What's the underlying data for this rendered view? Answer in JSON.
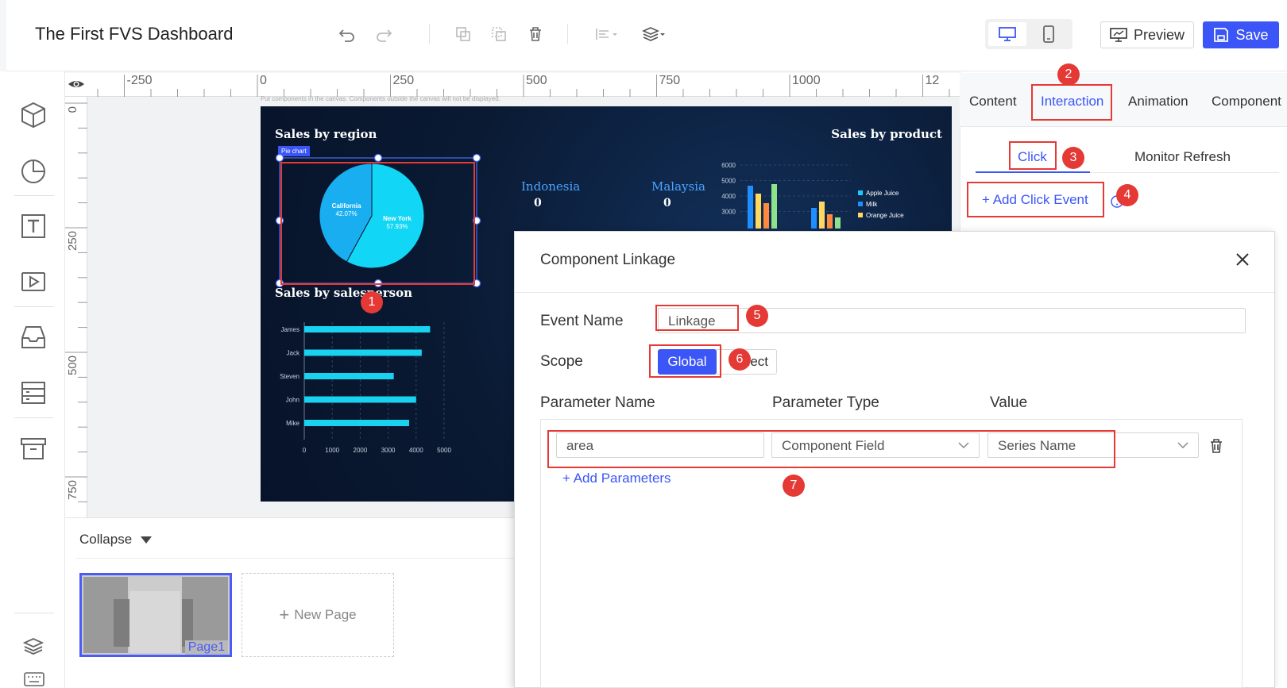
{
  "app": {
    "title": "The First FVS Dashboard",
    "preview_label": "Preview",
    "save_label": "Save",
    "accent": "#3b55f6"
  },
  "toolbar": {
    "icons": [
      "undo-icon",
      "redo-icon",
      "copy-icon",
      "paste-icon",
      "delete-icon",
      "align-icon",
      "layer-icon"
    ]
  },
  "sidebar": {
    "icons": [
      "component-icon",
      "chart-icon",
      "text-icon",
      "media-icon",
      "container-icon",
      "table-icon",
      "archive-icon",
      "layers-icon",
      "keyboard-icon"
    ]
  },
  "ruler": {
    "top_labels": [
      "-250",
      "0",
      "250",
      "500",
      "750",
      "1000",
      "12"
    ],
    "left_labels": [
      "0",
      "250",
      "500",
      "750"
    ]
  },
  "canvas": {
    "hint": "Put components in the canvas. Components outside the canvas will not be displayed.",
    "selected_tag": "Pie chart"
  },
  "dashboard": {
    "region_title": "Sales by region",
    "product_title": "Sales by product",
    "salesperson_title": "Sales by salesperson",
    "metrics": [
      {
        "name": "Indonesia",
        "value": "0"
      },
      {
        "name": "Malaysia",
        "value": "0"
      }
    ]
  },
  "chart_data": [
    {
      "type": "pie",
      "title": "Sales by region",
      "categories": [
        "California",
        "New York"
      ],
      "values": [
        42.07,
        57.93
      ],
      "labels": [
        "42.07%",
        "57.93%"
      ]
    },
    {
      "type": "bar",
      "title": "Sales by salesperson",
      "orientation": "horizontal",
      "categories": [
        "James",
        "Jack",
        "Steven",
        "John",
        "Mike"
      ],
      "values": [
        4500,
        4200,
        3200,
        4000,
        3750
      ],
      "xlim": [
        0,
        5000
      ],
      "xticks": [
        "0",
        "1000",
        "2000",
        "3000",
        "4000",
        "5000"
      ]
    },
    {
      "type": "bar",
      "title": "Sales by product",
      "yticks": [
        "6000",
        "5000",
        "4000",
        "3000"
      ],
      "series": [
        {
          "name": "Apple Juice",
          "color": "#1ec8ff"
        },
        {
          "name": "Milk",
          "color": "#1f8fff"
        },
        {
          "name": "Orange Juice",
          "color": "#ffd860"
        }
      ]
    }
  ],
  "pages": {
    "collapse_label": "Collapse",
    "page_label": "Page1",
    "new_page_label": "New Page"
  },
  "panel": {
    "tabs": [
      "Content",
      "Interaction",
      "Animation",
      "Component"
    ],
    "active_tab": "Interaction",
    "subtabs": [
      "Click",
      "Monitor Refresh"
    ],
    "add_click_label": "Add Click Event"
  },
  "dialog": {
    "title": "Component Linkage",
    "event_name_label": "Event Name",
    "event_name_value": "Linkage",
    "scope_label": "Scope",
    "scope_options": [
      "Global",
      "Select"
    ],
    "param_headers": [
      "Parameter Name",
      "Parameter Type",
      "Value"
    ],
    "param_row": {
      "name": "area",
      "type": "Component Field",
      "value": "Series Name"
    },
    "add_params_label": "Add Parameters"
  },
  "annotations": [
    "1",
    "2",
    "3",
    "4",
    "5",
    "6",
    "7"
  ],
  "annotation_color": "#e53935"
}
